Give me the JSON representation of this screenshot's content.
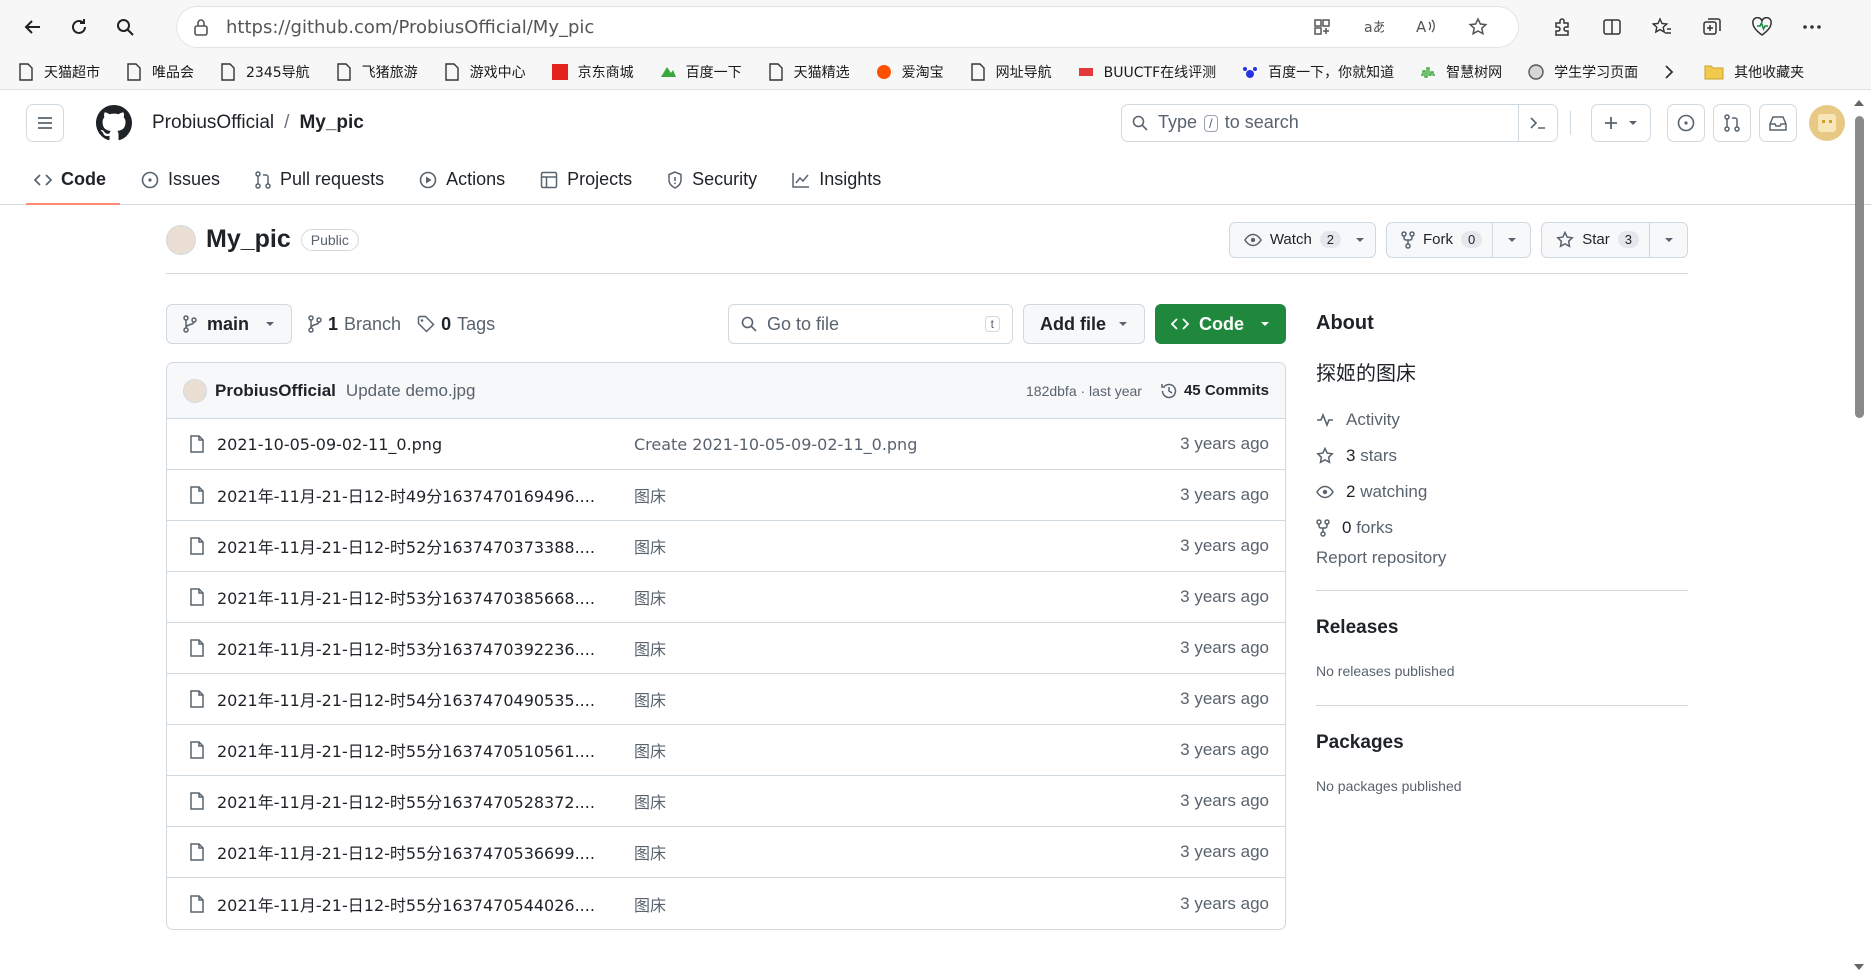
{
  "browser": {
    "url": "https://github.com/ProbiusOfficial/My_pic",
    "bookmarks": [
      "天猫超市",
      "唯品会",
      "2345导航",
      "飞猪旅游",
      "游戏中心",
      "京东商城",
      "百度一下",
      "天猫精选",
      "爱淘宝",
      "网址导航",
      "BUUCTF在线评测",
      "百度一下，你就知道",
      "智慧树网",
      "学生学习页面"
    ],
    "other_bookmarks": "其他收藏夹"
  },
  "header": {
    "owner": "ProbiusOfficial",
    "separator": "/",
    "repo": "My_pic",
    "search_prefix": "Type",
    "search_key": "/",
    "search_suffix": "to search"
  },
  "tabs": [
    {
      "label": "Code",
      "icon": "code-icon"
    },
    {
      "label": "Issues",
      "icon": "issue-icon"
    },
    {
      "label": "Pull requests",
      "icon": "pull-request-icon"
    },
    {
      "label": "Actions",
      "icon": "play-icon"
    },
    {
      "label": "Projects",
      "icon": "table-icon"
    },
    {
      "label": "Security",
      "icon": "shield-icon"
    },
    {
      "label": "Insights",
      "icon": "graph-icon"
    }
  ],
  "repo": {
    "title": "My_pic",
    "visibility": "Public",
    "watch_label": "Watch",
    "watch_count": "2",
    "fork_label": "Fork",
    "fork_count": "0",
    "star_label": "Star",
    "star_count": "3"
  },
  "file_nav": {
    "branch": "main",
    "branch_count": "1",
    "branch_label": "Branch",
    "tag_count": "0",
    "tag_label": "Tags",
    "goto_placeholder": "Go to file",
    "goto_key": "t",
    "add_file": "Add file",
    "code": "Code"
  },
  "commit": {
    "author": "ProbiusOfficial",
    "message": "Update demo.jpg",
    "hash_time": "182dbfa · last year",
    "commits": "45 Commits"
  },
  "files": [
    {
      "name": "2021-10-05-09-02-11_0.png",
      "commit": "Create 2021-10-05-09-02-11_0.png",
      "age": "3 years ago"
    },
    {
      "name": "2021年-11月-21-日12-时49分1637470169496....",
      "commit": "图床",
      "age": "3 years ago"
    },
    {
      "name": "2021年-11月-21-日12-时52分1637470373388....",
      "commit": "图床",
      "age": "3 years ago"
    },
    {
      "name": "2021年-11月-21-日12-时53分1637470385668....",
      "commit": "图床",
      "age": "3 years ago"
    },
    {
      "name": "2021年-11月-21-日12-时53分1637470392236....",
      "commit": "图床",
      "age": "3 years ago"
    },
    {
      "name": "2021年-11月-21-日12-时54分1637470490535....",
      "commit": "图床",
      "age": "3 years ago"
    },
    {
      "name": "2021年-11月-21-日12-时55分1637470510561....",
      "commit": "图床",
      "age": "3 years ago"
    },
    {
      "name": "2021年-11月-21-日12-时55分1637470528372....",
      "commit": "图床",
      "age": "3 years ago"
    },
    {
      "name": "2021年-11月-21-日12-时55分1637470536699....",
      "commit": "图床",
      "age": "3 years ago"
    },
    {
      "name": "2021年-11月-21-日12-时55分1637470544026....",
      "commit": "图床",
      "age": "3 years ago"
    }
  ],
  "about": {
    "heading": "About",
    "description": "探姬的图床",
    "activity": "Activity",
    "stars_count": "3",
    "stars_label": "stars",
    "watching_count": "2",
    "watching_label": "watching",
    "forks_count": "0",
    "forks_label": "forks",
    "report": "Report repository"
  },
  "releases": {
    "heading": "Releases",
    "note": "No releases published"
  },
  "packages": {
    "heading": "Packages",
    "note": "No packages published"
  },
  "colors": {
    "accent_green": "#1f883d",
    "tab_underline": "#fd8c73"
  }
}
